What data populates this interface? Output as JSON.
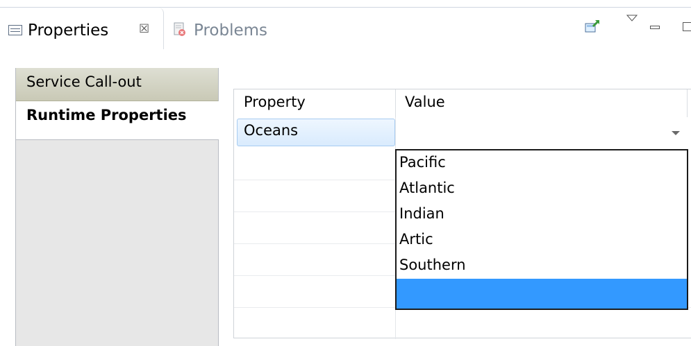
{
  "tabs": {
    "active_label": "Properties",
    "close_glyph": "☒",
    "inactive_label": "Problems",
    "icons": {
      "properties": "properties-table-icon",
      "problems": "problems-icon"
    }
  },
  "toolbar": {
    "pin_icon": "pin-view-icon",
    "menu_icon": "view-menu-icon",
    "minimize_icon": "minimize-icon",
    "maximize_icon": "maximize-icon"
  },
  "sections": {
    "items": [
      {
        "label": "Service Call-out"
      },
      {
        "label": "Runtime Properties"
      }
    ]
  },
  "table": {
    "headers": {
      "property": "Property",
      "value": "Value"
    },
    "rows": [
      {
        "property": "Oceans",
        "value": ""
      }
    ]
  },
  "dropdown": {
    "options": [
      "Pacific",
      "Atlantic",
      "Indian",
      "Artic",
      "Southern",
      ""
    ],
    "selected_index": 5
  },
  "colors": {
    "selection": "#3399ff",
    "section_active_bg": "#c9c9b6"
  }
}
